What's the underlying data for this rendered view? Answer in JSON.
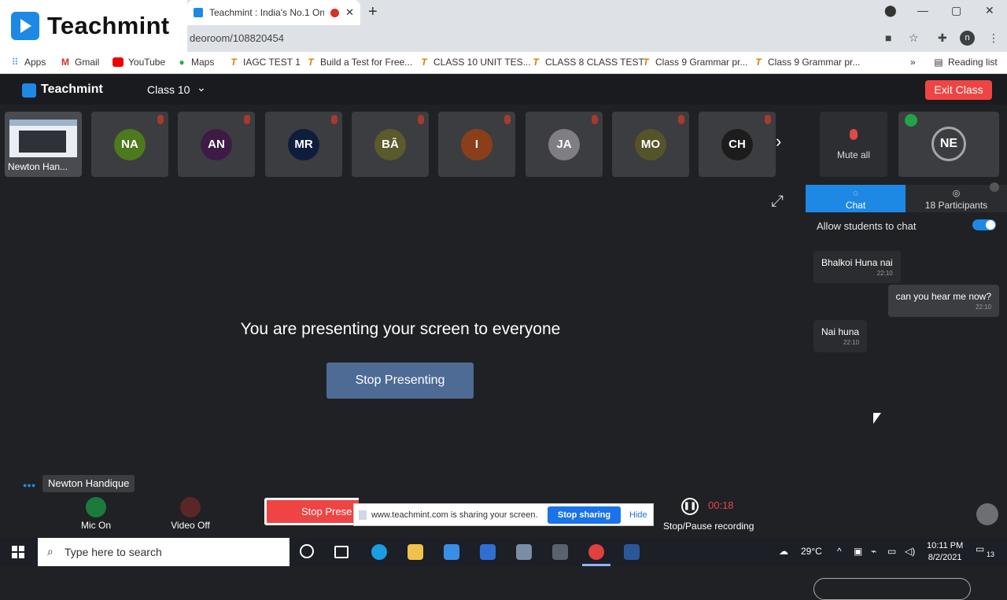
{
  "browser": {
    "brand_logo_text": "Teachmint",
    "tab_title": "Teachmint : India's No.1 Onl",
    "address": "deoroom/108820454",
    "profile_initial": "n",
    "bookmarks": [
      "Apps",
      "Gmail",
      "YouTube",
      "Maps",
      "IAGC TEST 1",
      "Build a Test for Free...",
      "CLASS 10 UNIT TES...",
      "CLASS 8 CLASS TEST",
      "Class 9 Grammar pr...",
      "Class 9 Grammar pr..."
    ],
    "reading_list": "Reading list"
  },
  "app": {
    "logo_text": "Teachmint",
    "class_name": "Class 10",
    "exit_label": "Exit Class",
    "self_tile_name": "Newton Han...",
    "participants": [
      {
        "initials": "NA",
        "color": "#4c7a1e"
      },
      {
        "initials": "AN",
        "color": "#3e1b47"
      },
      {
        "initials": "MR",
        "color": "#0f1d3d"
      },
      {
        "initials": "BĀ",
        "color": "#5a5a2a"
      },
      {
        "initials": "I",
        "color": "#8a3f1a"
      },
      {
        "initials": "JA",
        "color": "#7f7f83"
      },
      {
        "initials": "MO",
        "color": "#55532a"
      },
      {
        "initials": "CH",
        "color": "#1c1c1c"
      }
    ],
    "mute_all_label": "Mute all",
    "host_initials": "NE"
  },
  "stage": {
    "message": "You are presenting your screen to everyone",
    "stop_button": "Stop Presenting"
  },
  "sidebar": {
    "tab_chat": "Chat",
    "tab_participants": "18 Participants",
    "allow_label": "Allow students to chat",
    "messages": [
      {
        "text": "Bhalkoi Huna nai",
        "time": "22:10",
        "dir": "in"
      },
      {
        "text": "can you hear me now?",
        "time": "22:10",
        "dir": "out"
      },
      {
        "text": "Nai huna",
        "time": "22:10",
        "dir": "in"
      }
    ]
  },
  "controls": {
    "self_name": "Newton Handique",
    "mic_label": "Mic On",
    "video_label": "Video Off",
    "stop_present_short": "Stop Prese",
    "share_text": "www.teachmint.com is sharing your screen.",
    "stop_sharing": "Stop sharing",
    "hide": "Hide",
    "rec_time": "00:18",
    "rec_label": "Stop/Pause recording"
  },
  "taskbar": {
    "search_placeholder": "Type here to search",
    "weather": "29°C",
    "time": "10:11 PM",
    "date": "8/2/2021",
    "notif_count": "13"
  }
}
